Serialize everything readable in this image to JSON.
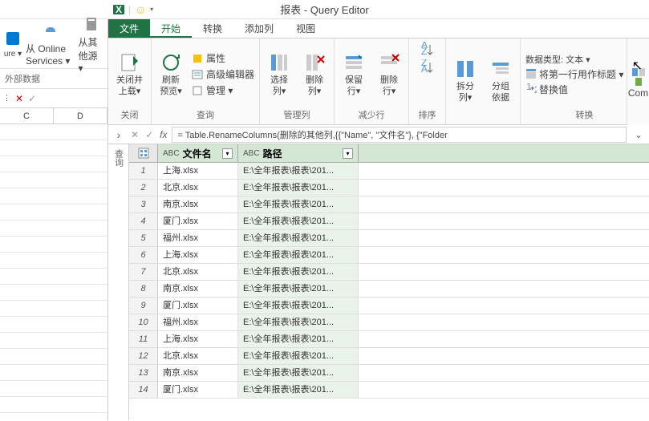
{
  "title": "报表 - Query Editor",
  "left_panel": {
    "buttons": [
      {
        "label": "从 Online Services ▾"
      },
      {
        "label": "从其他源 ▾"
      }
    ],
    "section_label": "外部数据",
    "columns": [
      "C",
      "D"
    ]
  },
  "tabs": {
    "file": "文件",
    "items": [
      "开始",
      "转换",
      "添加列",
      "视图"
    ],
    "active_index": 0
  },
  "ribbon": {
    "groups": [
      {
        "label": "关闭",
        "big": [
          {
            "label": "关闭并\n上载▾",
            "icon": "close-load"
          }
        ]
      },
      {
        "label": "查询",
        "big": [
          {
            "label": "刷新\n预览▾",
            "icon": "refresh"
          }
        ],
        "small": [
          {
            "label": "属性",
            "icon": "properties"
          },
          {
            "label": "高级编辑器",
            "icon": "advanced-editor"
          },
          {
            "label": "管理 ▾",
            "icon": "manage"
          }
        ]
      },
      {
        "label": "管理列",
        "big": [
          {
            "label": "选择\n列▾",
            "icon": "choose-cols"
          },
          {
            "label": "删除\n列▾",
            "icon": "remove-cols"
          }
        ]
      },
      {
        "label": "减少行",
        "big": [
          {
            "label": "保留\n行▾",
            "icon": "keep-rows"
          },
          {
            "label": "删除\n行▾",
            "icon": "remove-rows"
          }
        ]
      },
      {
        "label": "排序",
        "big": [
          {
            "label": "",
            "icon": "sort-asc"
          },
          {
            "label": "",
            "icon": "sort-desc"
          }
        ]
      },
      {
        "label": "",
        "big": [
          {
            "label": "拆分\n列▾",
            "icon": "split-col"
          },
          {
            "label": "分组\n依据",
            "icon": "group-by"
          }
        ]
      },
      {
        "label": "转换",
        "right": [
          "数据类型: 文本 ▾",
          "将第一行用作标题 ▾",
          "替换值"
        ]
      }
    ],
    "right_edge_label": "Com"
  },
  "formula_bar": {
    "fx": "fx",
    "formula": "= Table.RenameColumns(删除的其他列,{{\"Name\", \"文件名\"}, {\"Folder"
  },
  "grid": {
    "columns": [
      {
        "name": "文件名",
        "type": "ABC"
      },
      {
        "name": "路径",
        "type": "ABC"
      }
    ],
    "rows": [
      {
        "c1": "上海.xlsx",
        "c2": "E:\\全年报表\\报表\\201..."
      },
      {
        "c1": "北京.xlsx",
        "c2": "E:\\全年报表\\报表\\201..."
      },
      {
        "c1": "南京.xlsx",
        "c2": "E:\\全年报表\\报表\\201..."
      },
      {
        "c1": "厦门.xlsx",
        "c2": "E:\\全年报表\\报表\\201..."
      },
      {
        "c1": "福州.xlsx",
        "c2": "E:\\全年报表\\报表\\201..."
      },
      {
        "c1": "上海.xlsx",
        "c2": "E:\\全年报表\\报表\\201..."
      },
      {
        "c1": "北京.xlsx",
        "c2": "E:\\全年报表\\报表\\201..."
      },
      {
        "c1": "南京.xlsx",
        "c2": "E:\\全年报表\\报表\\201..."
      },
      {
        "c1": "厦门.xlsx",
        "c2": "E:\\全年报表\\报表\\201..."
      },
      {
        "c1": "福州.xlsx",
        "c2": "E:\\全年报表\\报表\\201..."
      },
      {
        "c1": "上海.xlsx",
        "c2": "E:\\全年报表\\报表\\201..."
      },
      {
        "c1": "北京.xlsx",
        "c2": "E:\\全年报表\\报表\\201..."
      },
      {
        "c1": "南京.xlsx",
        "c2": "E:\\全年报表\\报表\\201..."
      },
      {
        "c1": "厦门.xlsx",
        "c2": "E:\\全年报表\\报表\\201..."
      }
    ]
  },
  "side_label": "查询"
}
